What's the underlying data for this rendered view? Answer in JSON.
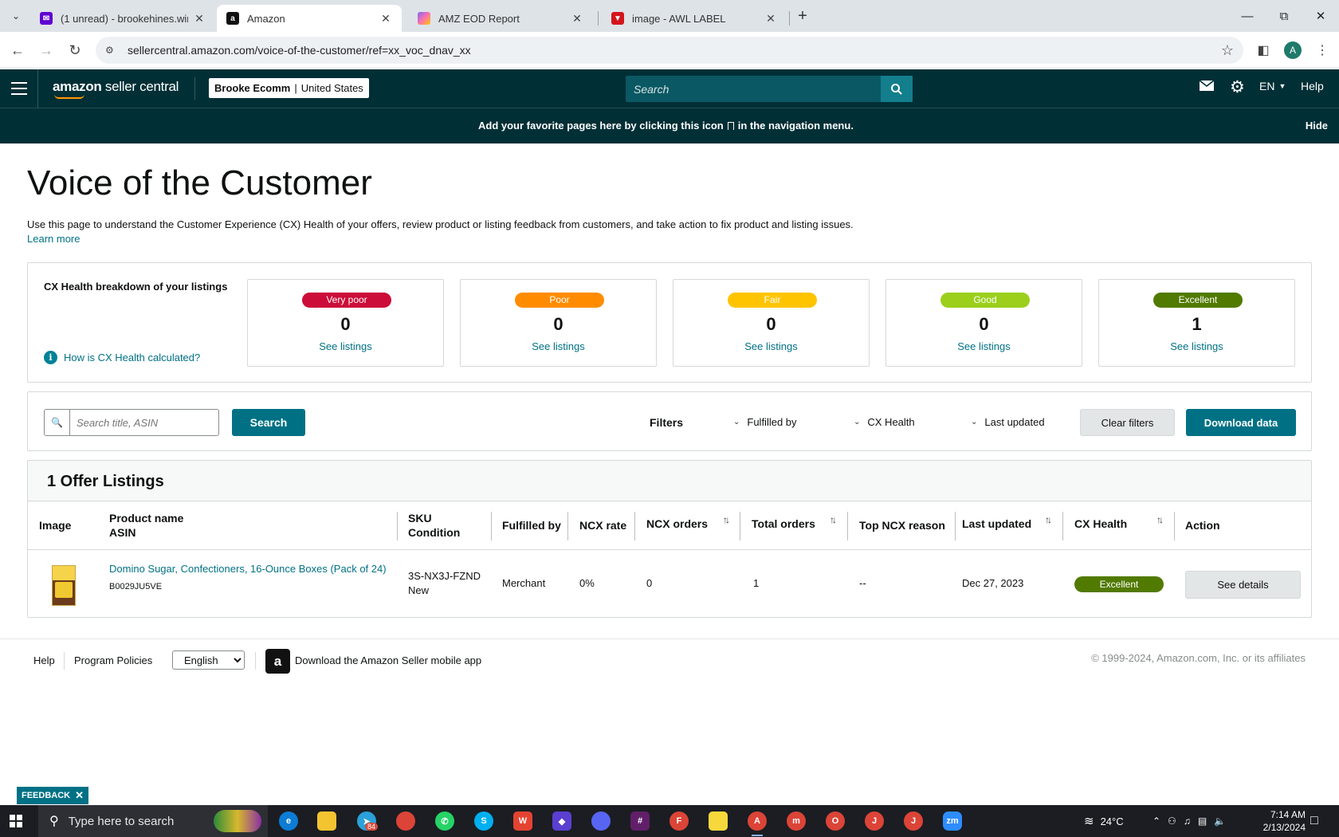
{
  "browser": {
    "tabs": [
      {
        "title": "(1 unread) - brookehines.winsor",
        "favicon": "yahoo-mail-icon",
        "color": "#6001d2"
      },
      {
        "title": "Amazon",
        "favicon": "amazon-icon",
        "color": "#111111"
      },
      {
        "title": "AMZ EOD Report",
        "favicon": "clickup-icon",
        "color": "#7b68ee"
      },
      {
        "title": "image - AWL LABEL",
        "favicon": "awl-icon",
        "color": "#d4141c"
      }
    ],
    "url": "sellercentral.amazon.com/voice-of-the-customer/ref=xx_voc_dnav_xx",
    "profile_initial": "A"
  },
  "header": {
    "logo_bold": "amazon",
    "logo_rest": " seller central",
    "store_name": "Brooke Ecomm",
    "store_region": "United States",
    "search_placeholder": "Search",
    "language": "EN",
    "help": "Help"
  },
  "favorites_bar": {
    "message_before": "Add your favorite pages here by clicking this icon",
    "message_after": "in the navigation menu.",
    "hide": "Hide"
  },
  "page": {
    "title": "Voice of the Customer",
    "description": "Use this page to understand the Customer Experience (CX) Health of your offers, review product or listing feedback from customers, and take action to fix product and listing issues.",
    "learn_more": "Learn more"
  },
  "cx_health": {
    "title": "CX Health breakdown of your listings",
    "how_link": "How is CX Health calculated?",
    "cards": [
      {
        "label": "Very poor",
        "count": "0",
        "link": "See listings",
        "color": "#cc0c39"
      },
      {
        "label": "Poor",
        "count": "0",
        "link": "See listings",
        "color": "#ff8c00"
      },
      {
        "label": "Fair",
        "count": "0",
        "link": "See listings",
        "color": "#ffc400"
      },
      {
        "label": "Good",
        "count": "0",
        "link": "See listings",
        "color": "#9bcf1c"
      },
      {
        "label": "Excellent",
        "count": "1",
        "link": "See listings",
        "color": "#517a00"
      }
    ]
  },
  "filters": {
    "search_placeholder": "Search title, ASIN",
    "search_button": "Search",
    "label": "Filters",
    "fulfilled_by": "Fulfilled by",
    "cx_health": "CX Health",
    "last_updated": "Last updated",
    "clear": "Clear filters",
    "download": "Download data"
  },
  "listings": {
    "heading": "1 Offer Listings",
    "columns": {
      "image": "Image",
      "product_name": "Product name",
      "asin": "ASIN",
      "sku": "SKU",
      "condition": "Condition",
      "fulfilled_by": "Fulfilled by",
      "ncx_rate": "NCX rate",
      "ncx_orders": "NCX orders",
      "total_orders": "Total orders",
      "top_ncx_reason": "Top NCX reason",
      "last_updated": "Last updated",
      "cx_health": "CX Health",
      "action": "Action"
    },
    "rows": [
      {
        "product_name": "Domino Sugar, Confectioners, 16-Ounce Boxes (Pack of 24)",
        "asin": "B0029JU5VE",
        "sku": "3S-NX3J-FZND",
        "condition": "New",
        "fulfilled_by": "Merchant",
        "ncx_rate": "0%",
        "ncx_orders": "0",
        "total_orders": "1",
        "top_ncx_reason": "--",
        "last_updated": "Dec 27, 2023",
        "cx_health": "Excellent",
        "action": "See details"
      }
    ]
  },
  "footer": {
    "help": "Help",
    "policies": "Program Policies",
    "language": "English",
    "app_text": "Download the Amazon Seller mobile app",
    "copyright": "© 1999-2024, Amazon.com, Inc. or its affiliates"
  },
  "feedback": "FEEDBACK",
  "taskbar": {
    "search_placeholder": "Type here to search",
    "telegram_badge": "84",
    "weather": "24°C",
    "time": "7:14 AM",
    "date": "2/13/2024"
  }
}
